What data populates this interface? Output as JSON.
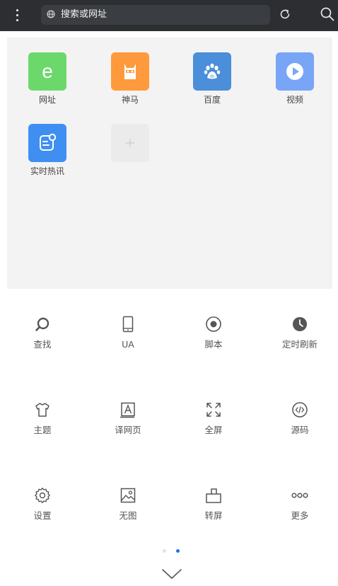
{
  "topbar": {
    "menu_icon": "vertical-dots-icon",
    "url_placeholder": "搜索或网址",
    "globe_icon": "globe-icon",
    "reload_icon": "reload-icon",
    "search_icon": "search-icon"
  },
  "speed_dial": [
    {
      "label": "网址",
      "icon": "letter-e-icon",
      "color": "#6cd86b"
    },
    {
      "label": "神马",
      "icon": "alpaca-icon",
      "color": "#ff9a3c"
    },
    {
      "label": "百度",
      "icon": "baidu-paw-icon",
      "color": "#4b8ed9"
    },
    {
      "label": "视频",
      "icon": "play-icon",
      "color": "#78a5f5"
    },
    {
      "label": "实时热讯",
      "icon": "news-icon",
      "color": "#3f8ff2"
    },
    {
      "label": "",
      "icon": "add-icon",
      "color": "#ebebeb"
    }
  ],
  "tools": [
    {
      "label": "查找",
      "icon": "find-icon"
    },
    {
      "label": "UA",
      "icon": "phone-icon"
    },
    {
      "label": "脚本",
      "icon": "script-icon"
    },
    {
      "label": "定时刷新",
      "icon": "clock-icon"
    },
    {
      "label": "主题",
      "icon": "shirt-icon"
    },
    {
      "label": "译网页",
      "icon": "translate-icon"
    },
    {
      "label": "全屏",
      "icon": "fullscreen-icon"
    },
    {
      "label": "源码",
      "icon": "source-code-icon"
    },
    {
      "label": "设置",
      "icon": "settings-icon"
    },
    {
      "label": "无图",
      "icon": "no-image-icon"
    },
    {
      "label": "转屏",
      "icon": "rotate-screen-icon"
    },
    {
      "label": "更多",
      "icon": "more-icon"
    }
  ],
  "pager": {
    "pages": 2,
    "active": 2,
    "active_color": "#1a73e8",
    "inactive_color": "#e0e0e0"
  },
  "collapse_icon": "chevron-down-icon"
}
